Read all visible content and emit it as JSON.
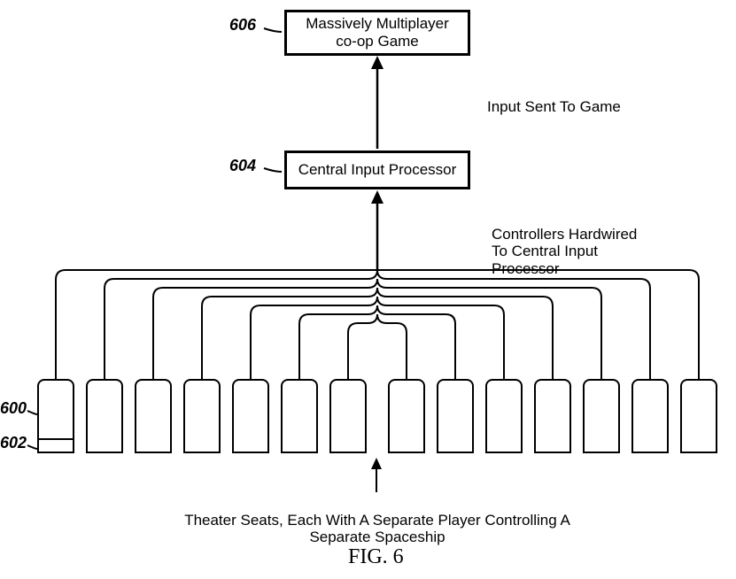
{
  "boxes": {
    "game": "Massively Multiplayer\nco-op Game",
    "processor": "Central Input Processor"
  },
  "labels": {
    "input_sent": "Input Sent To Game",
    "hardwired": "Controllers Hardwired\nTo Central Input\nProcessor",
    "seats_caption": "Theater Seats, Each With A Separate Player Controlling A\nSeparate Spaceship"
  },
  "refs": {
    "r606": "606",
    "r604": "604",
    "r600": "600",
    "r602": "602"
  },
  "figure": "FIG. 6"
}
